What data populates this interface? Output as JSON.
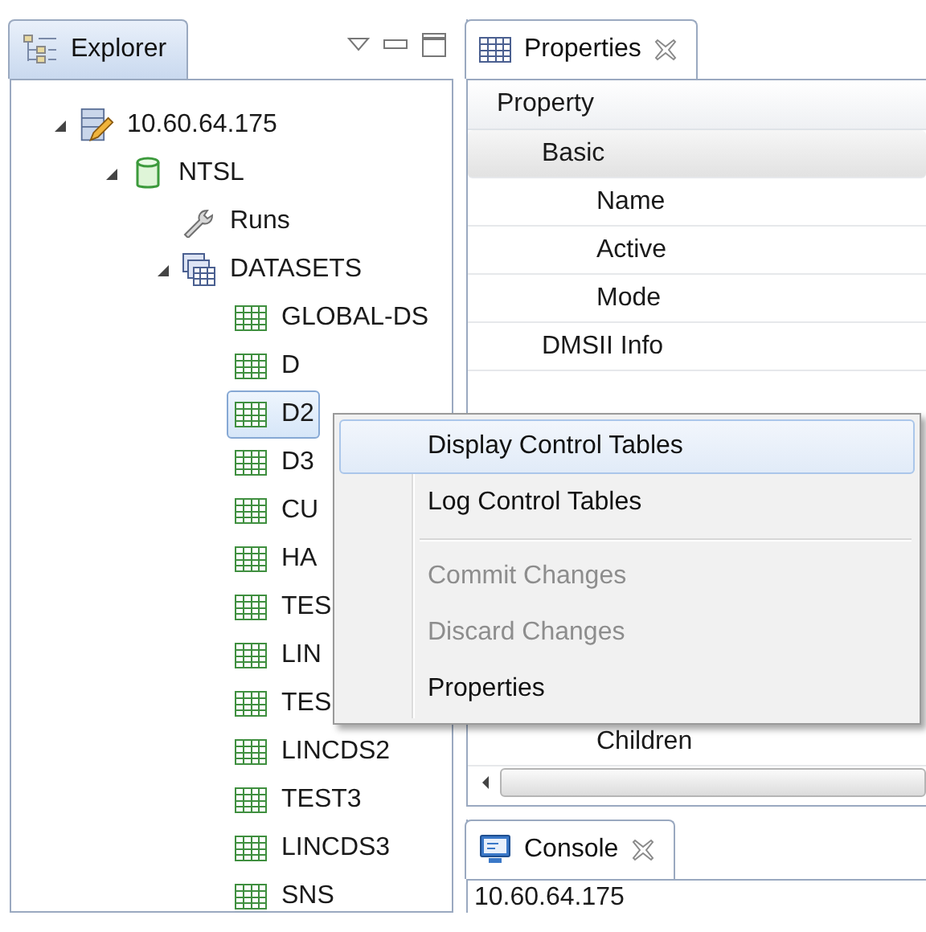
{
  "explorer": {
    "tab": {
      "label": "Explorer",
      "selected": true
    },
    "tree": [
      {
        "label": "10.60.64.175",
        "kind": "server",
        "expanded": true,
        "selected": false,
        "children": [
          {
            "label": "NTSL",
            "kind": "database",
            "expanded": true,
            "selected": false,
            "children": [
              {
                "label": "Runs",
                "kind": "runs",
                "selected": false
              },
              {
                "label": "DATASETS",
                "kind": "datasets",
                "expanded": true,
                "selected": false,
                "children": [
                  {
                    "label": "GLOBAL-DS",
                    "kind": "table",
                    "selected": false
                  },
                  {
                    "label": "D",
                    "kind": "table",
                    "selected": false
                  },
                  {
                    "label": "D2",
                    "kind": "table",
                    "selected": true
                  },
                  {
                    "label": "D3",
                    "kind": "table",
                    "selected": false
                  },
                  {
                    "label": "CU",
                    "kind": "table",
                    "selected": false
                  },
                  {
                    "label": "HA",
                    "kind": "table",
                    "selected": false
                  },
                  {
                    "label": "TES",
                    "kind": "table",
                    "selected": false
                  },
                  {
                    "label": "LIN",
                    "kind": "table",
                    "selected": false
                  },
                  {
                    "label": "TES",
                    "kind": "table",
                    "selected": false
                  },
                  {
                    "label": "LINCDS2",
                    "kind": "table",
                    "selected": false
                  },
                  {
                    "label": "TEST3",
                    "kind": "table",
                    "selected": false
                  },
                  {
                    "label": "LINCDS3",
                    "kind": "table",
                    "selected": false
                  },
                  {
                    "label": "SNS",
                    "kind": "table",
                    "selected": false
                  }
                ]
              }
            ]
          }
        ]
      }
    ]
  },
  "properties": {
    "tab": {
      "label": "Properties",
      "selected": false
    },
    "column": "Property",
    "rows": [
      {
        "label": "Basic",
        "kind": "group",
        "selected": true
      },
      {
        "label": "Name",
        "kind": "field",
        "selected": false
      },
      {
        "label": "Active",
        "kind": "field",
        "selected": false
      },
      {
        "label": "Mode",
        "kind": "field",
        "selected": false
      },
      {
        "label": "DMSII Info",
        "kind": "group",
        "selected": false
      }
    ],
    "bottom_rows": [
      {
        "label": "Children",
        "kind": "field",
        "selected": false
      }
    ]
  },
  "console": {
    "tab": {
      "label": "Console",
      "selected": false
    },
    "lines": [
      "10.60.64.175"
    ]
  },
  "context_menu": {
    "items": [
      {
        "kind": "item",
        "label": "Display Control Tables",
        "disabled": false,
        "selected": true
      },
      {
        "kind": "item",
        "label": "Log Control Tables",
        "disabled": false,
        "selected": false
      },
      {
        "kind": "separator"
      },
      {
        "kind": "item",
        "label": "Commit Changes",
        "disabled": true,
        "selected": false
      },
      {
        "kind": "item",
        "label": "Discard Changes",
        "disabled": true,
        "selected": false
      },
      {
        "kind": "item",
        "label": "Properties",
        "disabled": false,
        "selected": false
      }
    ]
  }
}
